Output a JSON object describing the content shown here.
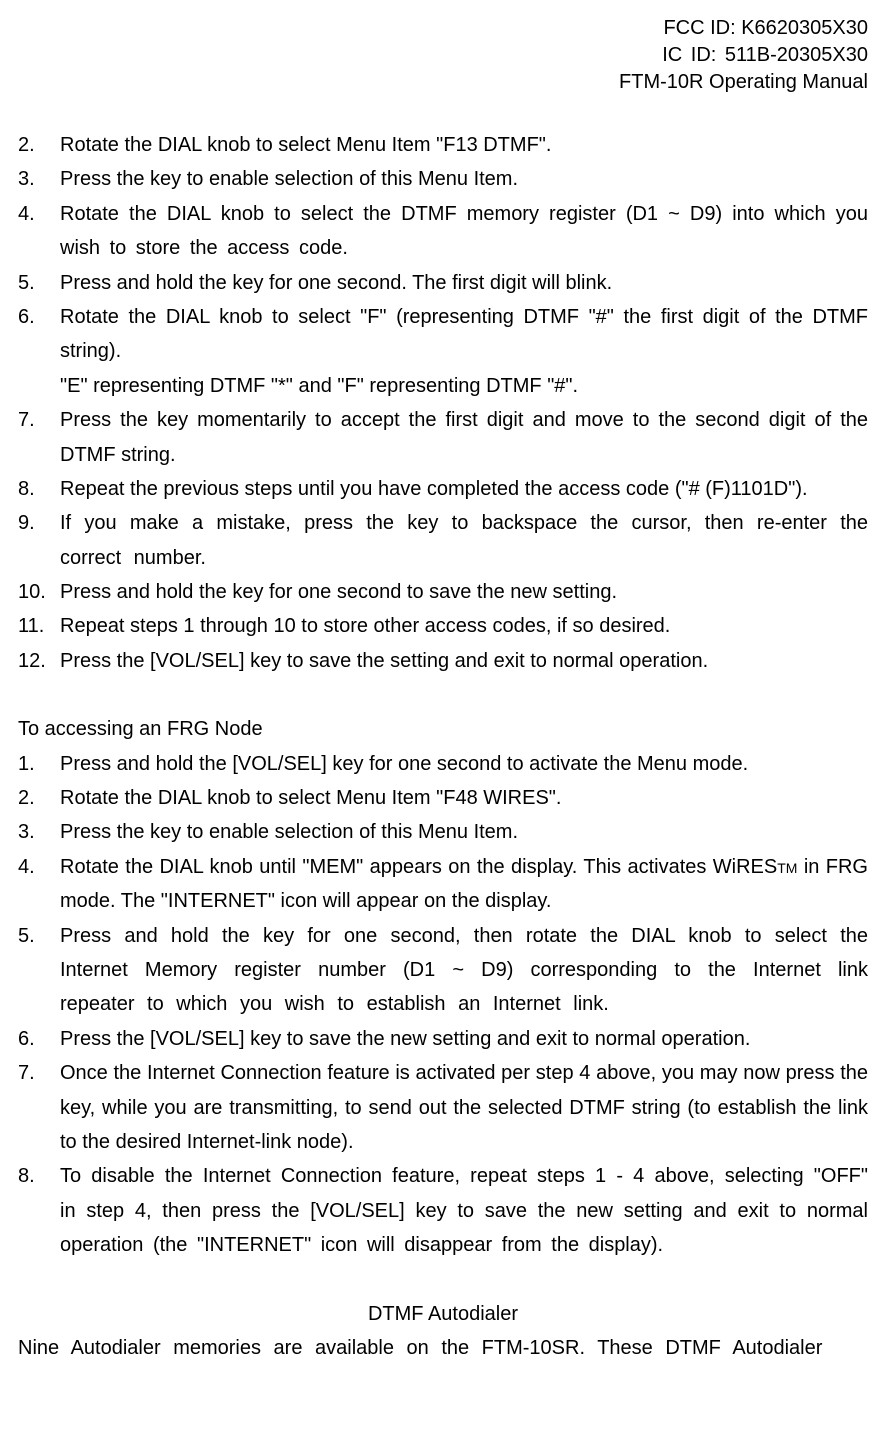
{
  "header": {
    "fcc": "FCC ID: K6620305X30",
    "ic": "IC  ID:  511B-20305X30",
    "model": "FTM-10R Operating Manual"
  },
  "stepsA": [
    {
      "num": "2.",
      "text": "Rotate the DIAL knob to select Menu Item \"F13 DTMF\"."
    },
    {
      "num": "3.",
      "text": "Press the     key to enable selection of this Menu Item."
    },
    {
      "num": "4.",
      "text": "Rotate the DIAL knob to select the DTMF memory register (D1 ~ D9) into which you wish to store the access code."
    },
    {
      "num": "5.",
      "text": "Press and hold the     key for one second. The first digit will blink."
    },
    {
      "num": "6.",
      "text": "Rotate the DIAL knob to select \"F\" (representing DTMF \"#\" the first digit of the DTMF string).",
      "sub": "\"E\" representing DTMF \"*\" and \"F\" representing DTMF \"#\"."
    },
    {
      "num": "7.",
      "text": "Press the     key momentarily to accept the first digit and move to the second digit of the DTMF string."
    },
    {
      "num": "8.",
      "text": "Repeat the previous steps until you have completed the access code (\"# (F)1101D\")."
    },
    {
      "num": "9.",
      "text": "If you make a mistake, press the   key to backspace the cursor, then re-enter the correct number."
    },
    {
      "num": "10.",
      "text": "Press and hold the     key for one second to save the new setting."
    },
    {
      "num": "11.",
      "text": "Repeat steps 1 through 10 to store other access codes, if so desired."
    },
    {
      "num": "12.",
      "text": "Press the [VOL/SEL] key to save the setting and exit to normal operation."
    }
  ],
  "headingB": "To accessing an FRG Node",
  "stepsB": [
    {
      "num": "1.",
      "text": "Press and hold the [VOL/SEL] key for one second to activate the Menu mode."
    },
    {
      "num": "2.",
      "text": "Rotate the DIAL knob to select Menu Item \"F48 WIRES\"."
    },
    {
      "num": "3.",
      "text": "Press the     key to enable selection of this Menu Item."
    },
    {
      "num": "4.",
      "pre": "Rotate the DIAL knob until \"MEM\" appears on the display. This activates WiRES",
      "tm": "TM",
      "post": "   in FRG mode. The \"INTERNET\" icon will appear on the display."
    },
    {
      "num": "5.",
      "text": "Press and hold the   key for one second, then rotate the DIAL knob to select the Internet Memory register number (D1 ~ D9) corresponding to the Internet link repeater to which you wish to establish an Internet link."
    },
    {
      "num": "6.",
      "text": "Press the [VOL/SEL] key to save the new setting and exit to normal operation."
    },
    {
      "num": "7.",
      "text": "Once the Internet Connection feature is activated per step 4 above, you may now press the     key, while you are transmitting, to send out the selected DTMF string (to establish the link to the desired Internet-link node)."
    },
    {
      "num": "8.",
      "text": "To disable the Internet Connection feature, repeat steps 1 - 4 above, selecting \"OFF\" in step 4, then press the [VOL/SEL] key to save the new setting and exit to normal operation (the \"INTERNET\" icon will disappear from the display)."
    }
  ],
  "headingC": "DTMF Autodialer",
  "paraC": "Nine Autodialer memories are available on the FTM-10SR. These DTMF Autodialer"
}
